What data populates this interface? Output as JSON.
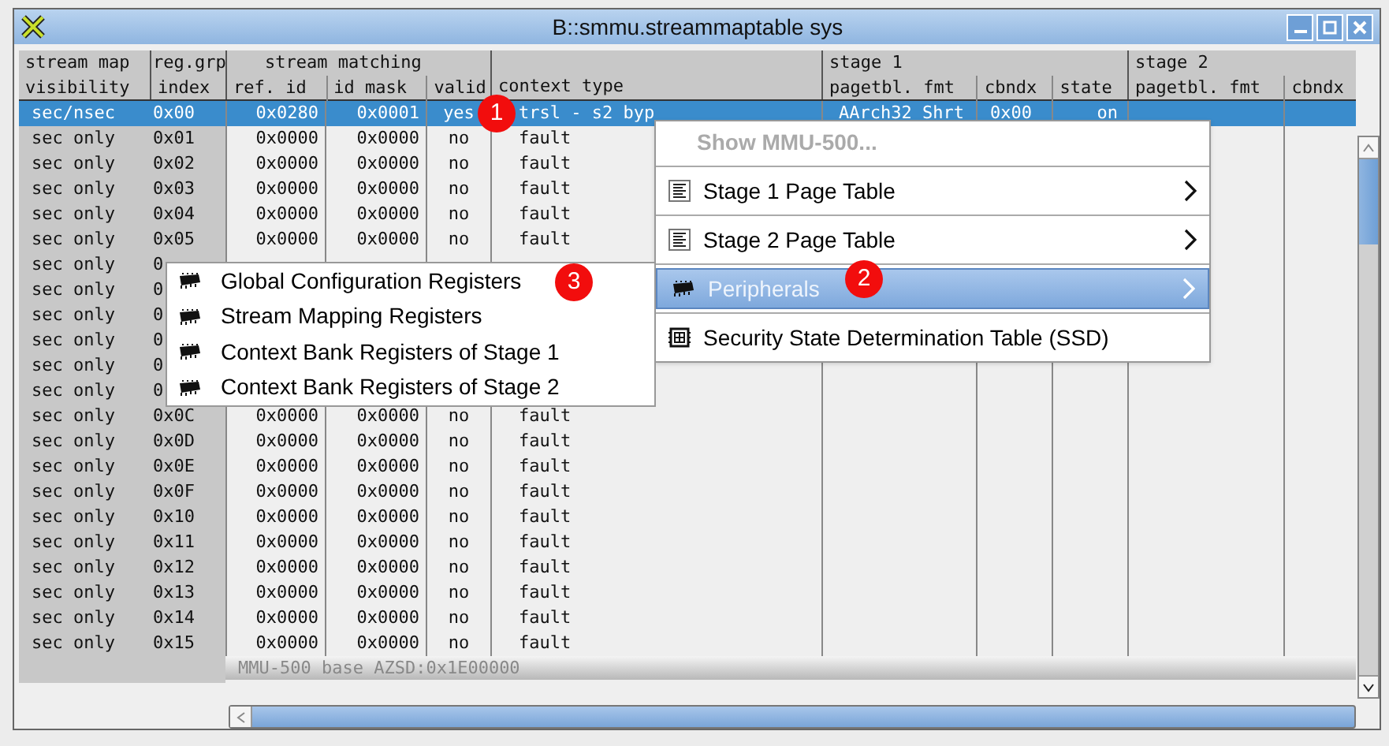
{
  "window": {
    "title": "B::smmu.streammaptable sys"
  },
  "header_groups": [
    {
      "label": "stream map",
      "columns": [
        "visibility"
      ]
    },
    {
      "label": "reg.grp",
      "columns": [
        "index"
      ]
    },
    {
      "label": "stream matching",
      "columns": [
        "ref. id",
        "id mask",
        "valid"
      ]
    },
    {
      "columns": [
        "context type"
      ]
    },
    {
      "label": "stage 1",
      "columns": [
        "pagetbl. fmt",
        "cbndx",
        "state"
      ]
    },
    {
      "label": "stage 2",
      "columns": [
        "pagetbl. fmt",
        "cbndx"
      ]
    }
  ],
  "rows": [
    {
      "selected": true,
      "cells": [
        "sec/nsec",
        "0x00",
        "0x0280",
        "0x0001",
        "yes",
        "trsl - s2 byp",
        "AArch32 Shrt",
        "0x00",
        "on"
      ]
    },
    {
      "selected": false,
      "cells": [
        "sec only",
        "0x01",
        "0x0000",
        "0x0000",
        "no",
        "fault"
      ]
    },
    {
      "selected": false,
      "cells": [
        "sec only",
        "0x02",
        "0x0000",
        "0x0000",
        "no",
        "fault"
      ]
    },
    {
      "selected": false,
      "cells": [
        "sec only",
        "0x03",
        "0x0000",
        "0x0000",
        "no",
        "fault"
      ]
    },
    {
      "selected": false,
      "cells": [
        "sec only",
        "0x04",
        "0x0000",
        "0x0000",
        "no",
        "fault"
      ]
    },
    {
      "selected": false,
      "cells": [
        "sec only",
        "0x05",
        "0x0000",
        "0x0000",
        "no",
        "fault"
      ]
    },
    {
      "selected": false,
      "cells": [
        "sec only",
        "0"
      ]
    },
    {
      "selected": false,
      "cells": [
        "sec only",
        "0"
      ]
    },
    {
      "selected": false,
      "cells": [
        "sec only",
        "0"
      ]
    },
    {
      "selected": false,
      "cells": [
        "sec only",
        "0"
      ]
    },
    {
      "selected": false,
      "cells": [
        "sec only",
        "0"
      ]
    },
    {
      "selected": false,
      "cells": [
        "sec only",
        "0"
      ]
    },
    {
      "selected": false,
      "cells": [
        "sec only",
        "0x0C",
        "0x0000",
        "0x0000",
        "no",
        "fault"
      ]
    },
    {
      "selected": false,
      "cells": [
        "sec only",
        "0x0D",
        "0x0000",
        "0x0000",
        "no",
        "fault"
      ]
    },
    {
      "selected": false,
      "cells": [
        "sec only",
        "0x0E",
        "0x0000",
        "0x0000",
        "no",
        "fault"
      ]
    },
    {
      "selected": false,
      "cells": [
        "sec only",
        "0x0F",
        "0x0000",
        "0x0000",
        "no",
        "fault"
      ]
    },
    {
      "selected": false,
      "cells": [
        "sec only",
        "0x10",
        "0x0000",
        "0x0000",
        "no",
        "fault"
      ]
    },
    {
      "selected": false,
      "cells": [
        "sec only",
        "0x11",
        "0x0000",
        "0x0000",
        "no",
        "fault"
      ]
    },
    {
      "selected": false,
      "cells": [
        "sec only",
        "0x12",
        "0x0000",
        "0x0000",
        "no",
        "fault"
      ]
    },
    {
      "selected": false,
      "cells": [
        "sec only",
        "0x13",
        "0x0000",
        "0x0000",
        "no",
        "fault"
      ]
    },
    {
      "selected": false,
      "cells": [
        "sec only",
        "0x14",
        "0x0000",
        "0x0000",
        "no",
        "fault"
      ]
    },
    {
      "selected": false,
      "cells": [
        "sec only",
        "0x15",
        "0x0000",
        "0x0000",
        "no",
        "fault"
      ]
    }
  ],
  "status_bar": "MMU-500  base AZSD:0x1E00000",
  "context_menu": [
    {
      "label": "Show MMU-500...",
      "kind": "plain",
      "disabled": true,
      "selected": false,
      "submenu": false
    },
    {
      "label": "Stage 1 Page Table",
      "kind": "table",
      "disabled": false,
      "selected": false,
      "submenu": true
    },
    {
      "label": "Stage 2 Page Table",
      "kind": "table",
      "disabled": false,
      "selected": false,
      "submenu": true
    },
    {
      "label": "Peripherals",
      "kind": "chip",
      "disabled": false,
      "selected": true,
      "submenu": true
    },
    {
      "label": "Security State Determination Table (SSD)",
      "kind": "grid",
      "disabled": false,
      "selected": false,
      "submenu": false
    }
  ],
  "submenu": [
    {
      "label": "Global Configuration Registers"
    },
    {
      "label": "Stream Mapping Registers"
    },
    {
      "label": "Context Bank Registers of Stage 1"
    },
    {
      "label": "Context Bank Registers of Stage 2"
    }
  ],
  "annotations": [
    "1",
    "2",
    "3"
  ]
}
